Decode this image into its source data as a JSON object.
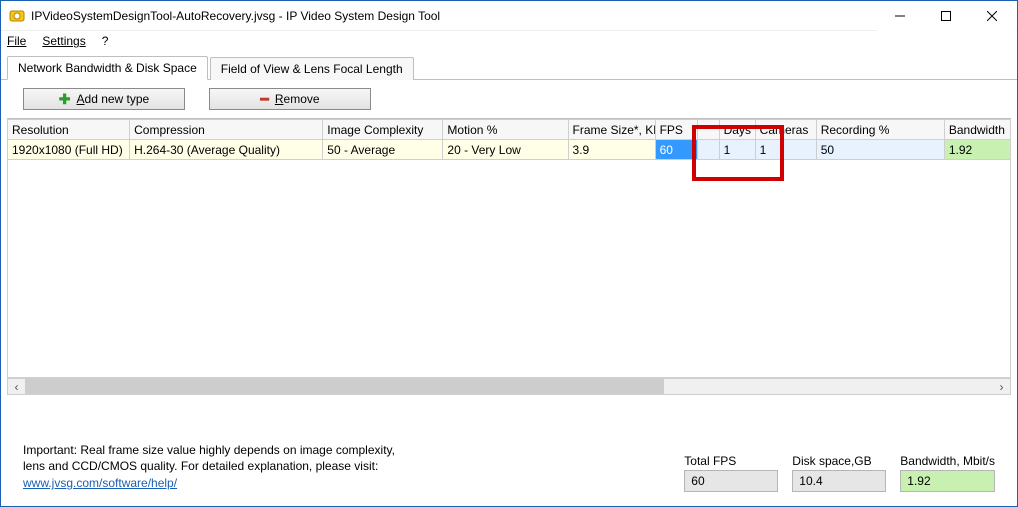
{
  "window": {
    "title": "IPVideoSystemDesignTool-AutoRecovery.jvsg - IP Video System Design Tool"
  },
  "menu": {
    "file": "File",
    "settings": "Settings",
    "help": "?"
  },
  "tabs": {
    "t0": "Network Bandwidth & Disk Space",
    "t1": "Field of View & Lens Focal Length"
  },
  "toolbar": {
    "add": "dd new type",
    "add_u": "A",
    "remove": "emove",
    "remove_u": "R"
  },
  "columns": {
    "c0": "Resolution",
    "c1": "Compression",
    "c2": "Image Complexity",
    "c3": "Motion %",
    "c4": "Frame Size*, KB",
    "c5": "FPS",
    "c6": "",
    "c7": "Days",
    "c8": "Cameras",
    "c9": "Recording %",
    "c10": "Bandwidth"
  },
  "row0": {
    "resolution": "1920x1080 (Full HD)",
    "compression": "H.264-30 (Average Quality)",
    "complexity": "50 - Average",
    "motion": "20 - Very Low",
    "framesize": "3.9",
    "fps": "60",
    "days": "1",
    "cameras": "1",
    "recording": "50",
    "bandwidth": "1.92"
  },
  "footer": {
    "note_line1": "Important: Real frame size value highly depends on image complexity,",
    "note_line2": "lens and CCD/CMOS quality. For detailed explanation, please visit:",
    "note_link": "www.jvsg.com/software/help/",
    "total_fps_label": "Total FPS",
    "total_fps": "60",
    "disk_label": "Disk space,GB",
    "disk": "10.4",
    "bw_label": "Bandwidth, Mbit/s",
    "bw": "1.92"
  }
}
